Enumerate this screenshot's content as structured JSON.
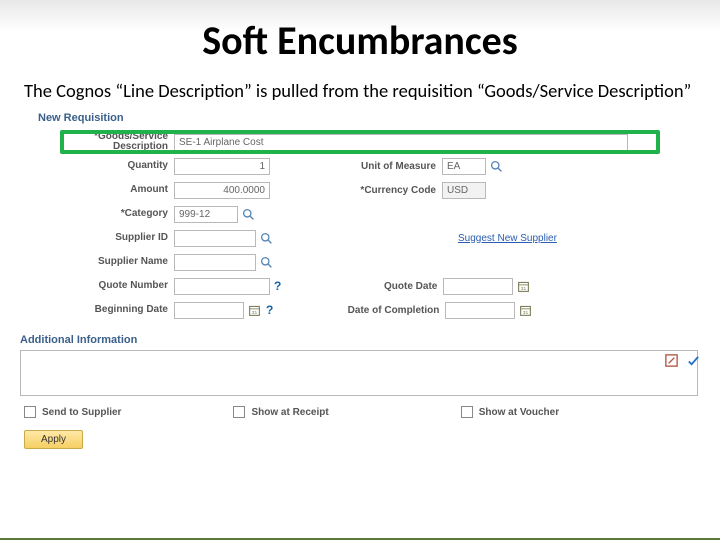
{
  "slide": {
    "title": "Soft Encumbrances",
    "caption": "The Cognos “Line Description” is pulled from the requisition “Goods/Service Description”"
  },
  "form": {
    "section_title": "New Requisition",
    "fields": {
      "goods_service_desc": {
        "label": "*Goods/Service Description",
        "value": "SE-1 Airplane Cost"
      },
      "quantity": {
        "label": "Quantity",
        "value": "1"
      },
      "unit_of_measure": {
        "label": "Unit of Measure",
        "value": "EA"
      },
      "amount": {
        "label": "Amount",
        "value": "400.0000"
      },
      "currency_code": {
        "label": "*Currency Code",
        "value": "USD"
      },
      "category": {
        "label": "*Category",
        "value": "999-12"
      },
      "supplier_id": {
        "label": "Supplier ID",
        "value": ""
      },
      "suggest_supplier_link": "Suggest New Supplier",
      "supplier_name": {
        "label": "Supplier Name",
        "value": ""
      },
      "quote_number": {
        "label": "Quote Number",
        "value": ""
      },
      "quote_date": {
        "label": "Quote Date",
        "value": ""
      },
      "beginning_date": {
        "label": "Beginning Date",
        "value": ""
      },
      "date_completion": {
        "label": "Date of Completion",
        "value": ""
      }
    },
    "additional_info_title": "Additional Information",
    "checkboxes": {
      "send_to_supplier": "Send to Supplier",
      "show_at_receipt": "Show at Receipt",
      "show_at_voucher": "Show at Voucher"
    },
    "apply_button": "Apply"
  }
}
